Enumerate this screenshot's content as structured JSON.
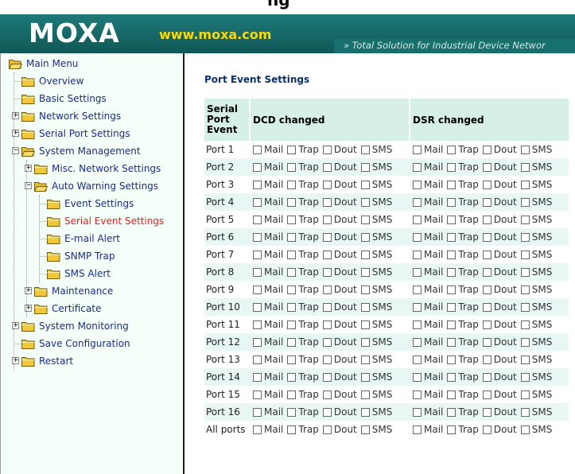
{
  "top_partial": "ng",
  "header": {
    "logo": "MOXA",
    "site": "www.moxa.com",
    "tagline": "» Total Solution for Industrial Device Networ"
  },
  "menu": [
    {
      "label": "Main Menu",
      "level": 0,
      "exp": "",
      "open": true
    },
    {
      "label": "Overview",
      "level": 1,
      "exp": ""
    },
    {
      "label": "Basic Settings",
      "level": 1,
      "exp": ""
    },
    {
      "label": "Network Settings",
      "level": 1,
      "exp": "+"
    },
    {
      "label": "Serial Port Settings",
      "level": 1,
      "exp": "+"
    },
    {
      "label": "System Management",
      "level": 1,
      "exp": "-",
      "open": true
    },
    {
      "label": "Misc. Network Settings",
      "level": 2,
      "exp": "+"
    },
    {
      "label": "Auto Warning Settings",
      "level": 2,
      "exp": "-",
      "open": true
    },
    {
      "label": "Event Settings",
      "level": 3,
      "exp": ""
    },
    {
      "label": "Serial Event Settings",
      "level": 3,
      "exp": "",
      "active": true
    },
    {
      "label": "E-mail Alert",
      "level": 3,
      "exp": ""
    },
    {
      "label": "SNMP Trap",
      "level": 3,
      "exp": ""
    },
    {
      "label": "SMS Alert",
      "level": 3,
      "exp": ""
    },
    {
      "label": "Maintenance",
      "level": 2,
      "exp": "+"
    },
    {
      "label": "Certificate",
      "level": 2,
      "exp": "+"
    },
    {
      "label": "System Monitoring",
      "level": 1,
      "exp": "+"
    },
    {
      "label": "Save Configuration",
      "level": 1,
      "exp": ""
    },
    {
      "label": "Restart",
      "level": 1,
      "exp": "+"
    }
  ],
  "main": {
    "title": "Port Event Settings",
    "headers": {
      "col1": "Serial Port Event",
      "dcd": "DCD changed",
      "dsr": "DSR changed"
    },
    "options": [
      "Mail",
      "Trap",
      "Dout",
      "SMS"
    ],
    "rows": [
      "Port 1",
      "Port 2",
      "Port 3",
      "Port 4",
      "Port 5",
      "Port 6",
      "Port 7",
      "Port 8",
      "Port 9",
      "Port 10",
      "Port 11",
      "Port 12",
      "Port 13",
      "Port 14",
      "Port 15",
      "Port 16",
      "All ports"
    ]
  }
}
